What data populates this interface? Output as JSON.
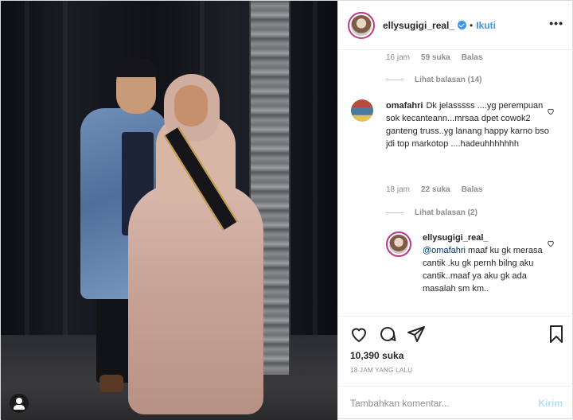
{
  "post": {
    "username": "ellysugigi_real_",
    "verified": true,
    "follow_label": "Ikuti",
    "separator": "•",
    "more_label": "•••"
  },
  "comments": {
    "first_meta": {
      "time": "16 jam",
      "likes": "59 suka",
      "reply": "Balas"
    },
    "first_replies": "Lihat balasan (14)",
    "second": {
      "username": "omafahri",
      "text": "Dk jelasssss ....yg perempuan sok kecanteann...mrsaa dpet cowok2 ganteng truss..yg lanang happy karno bso jdi top markotop ....hadeuhhhhhhh",
      "time": "18 jam",
      "likes": "22 suka",
      "reply": "Balas"
    },
    "second_replies": "Lihat balasan (2)",
    "reply": {
      "username": "ellysugigi_real_",
      "mention": "@omafahri",
      "text": " maaf ku gk merasa cantik .ku gk pernh bilng aku cantik..maaf ya aku gk ada masalah sm km.."
    }
  },
  "actions": {
    "likes": "10,390 suka",
    "timestamp": "18 JAM YANG LALU"
  },
  "add_comment": {
    "placeholder": "Tambahkan komentar...",
    "send_label": "Kirim"
  },
  "colors": {
    "accent": "#3897f0",
    "text": "#262626",
    "muted": "#8e8e8e",
    "send_disabled": "#b2dffc",
    "story_ring": "#c13584"
  },
  "icons": [
    "profile-icon",
    "verified-icon",
    "more-icon",
    "heart-icon",
    "comment-icon",
    "share-icon",
    "bookmark-icon"
  ]
}
